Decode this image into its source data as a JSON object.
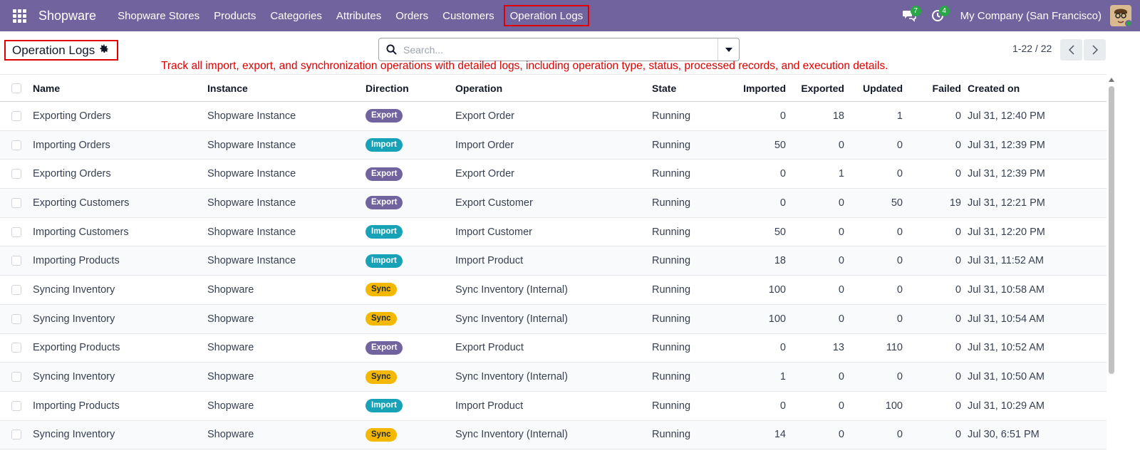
{
  "navbar": {
    "brand": "Shopware",
    "items": [
      {
        "label": "Shopware Stores"
      },
      {
        "label": "Products"
      },
      {
        "label": "Categories"
      },
      {
        "label": "Attributes"
      },
      {
        "label": "Orders"
      },
      {
        "label": "Customers"
      },
      {
        "label": "Operation Logs"
      }
    ],
    "messages_count": "7",
    "activities_count": "4",
    "company": "My Company (San Francisco)"
  },
  "control": {
    "title": "Operation Logs",
    "search_placeholder": "Search...",
    "pager": "1-22 / 22",
    "annotation": "Track all import, export, and synchronization operations with detailed logs, including operation type, status, processed records, and execution details."
  },
  "table": {
    "headers": {
      "name": "Name",
      "instance": "Instance",
      "direction": "Direction",
      "operation": "Operation",
      "state": "State",
      "imported": "Imported",
      "exported": "Exported",
      "updated": "Updated",
      "failed": "Failed",
      "created": "Created on"
    },
    "rows": [
      {
        "name": "Exporting Orders",
        "instance": "Shopware Instance",
        "direction": "Export",
        "operation": "Export Order",
        "state": "Running",
        "imported": "0",
        "exported": "18",
        "updated": "1",
        "failed": "0",
        "created": "Jul 31, 12:40 PM"
      },
      {
        "name": "Importing Orders",
        "instance": "Shopware Instance",
        "direction": "Import",
        "operation": "Import Order",
        "state": "Running",
        "imported": "50",
        "exported": "0",
        "updated": "0",
        "failed": "0",
        "created": "Jul 31, 12:39 PM"
      },
      {
        "name": "Exporting Orders",
        "instance": "Shopware Instance",
        "direction": "Export",
        "operation": "Export Order",
        "state": "Running",
        "imported": "0",
        "exported": "1",
        "updated": "0",
        "failed": "0",
        "created": "Jul 31, 12:39 PM"
      },
      {
        "name": "Exporting Customers",
        "instance": "Shopware Instance",
        "direction": "Export",
        "operation": "Export Customer",
        "state": "Running",
        "imported": "0",
        "exported": "0",
        "updated": "50",
        "failed": "19",
        "created": "Jul 31, 12:21 PM"
      },
      {
        "name": "Importing Customers",
        "instance": "Shopware Instance",
        "direction": "Import",
        "operation": "Import Customer",
        "state": "Running",
        "imported": "50",
        "exported": "0",
        "updated": "0",
        "failed": "0",
        "created": "Jul 31, 12:20 PM"
      },
      {
        "name": "Importing Products",
        "instance": "Shopware Instance",
        "direction": "Import",
        "operation": "Import Product",
        "state": "Running",
        "imported": "18",
        "exported": "0",
        "updated": "0",
        "failed": "0",
        "created": "Jul 31, 11:52 AM"
      },
      {
        "name": "Syncing Inventory",
        "instance": "Shopware",
        "direction": "Sync",
        "operation": "Sync Inventory (Internal)",
        "state": "Running",
        "imported": "100",
        "exported": "0",
        "updated": "0",
        "failed": "0",
        "created": "Jul 31, 10:58 AM"
      },
      {
        "name": "Syncing Inventory",
        "instance": "Shopware",
        "direction": "Sync",
        "operation": "Sync Inventory (Internal)",
        "state": "Running",
        "imported": "100",
        "exported": "0",
        "updated": "0",
        "failed": "0",
        "created": "Jul 31, 10:54 AM"
      },
      {
        "name": "Exporting Products",
        "instance": "Shopware",
        "direction": "Export",
        "operation": "Export Product",
        "state": "Running",
        "imported": "0",
        "exported": "13",
        "updated": "110",
        "failed": "0",
        "created": "Jul 31, 10:52 AM"
      },
      {
        "name": "Syncing Inventory",
        "instance": "Shopware",
        "direction": "Sync",
        "operation": "Sync Inventory (Internal)",
        "state": "Running",
        "imported": "1",
        "exported": "0",
        "updated": "0",
        "failed": "0",
        "created": "Jul 31, 10:50 AM"
      },
      {
        "name": "Importing Products",
        "instance": "Shopware",
        "direction": "Import",
        "operation": "Import Product",
        "state": "Running",
        "imported": "0",
        "exported": "0",
        "updated": "100",
        "failed": "0",
        "created": "Jul 31, 10:29 AM"
      },
      {
        "name": "Syncing Inventory",
        "instance": "Shopware",
        "direction": "Sync",
        "operation": "Sync Inventory (Internal)",
        "state": "Running",
        "imported": "14",
        "exported": "0",
        "updated": "0",
        "failed": "0",
        "created": "Jul 30, 6:51 PM"
      }
    ]
  },
  "colors": {
    "navbar": "#71639e",
    "export": "#71639e",
    "import": "#17a2b8",
    "sync": "#f5b800",
    "highlight": "#e00000"
  }
}
